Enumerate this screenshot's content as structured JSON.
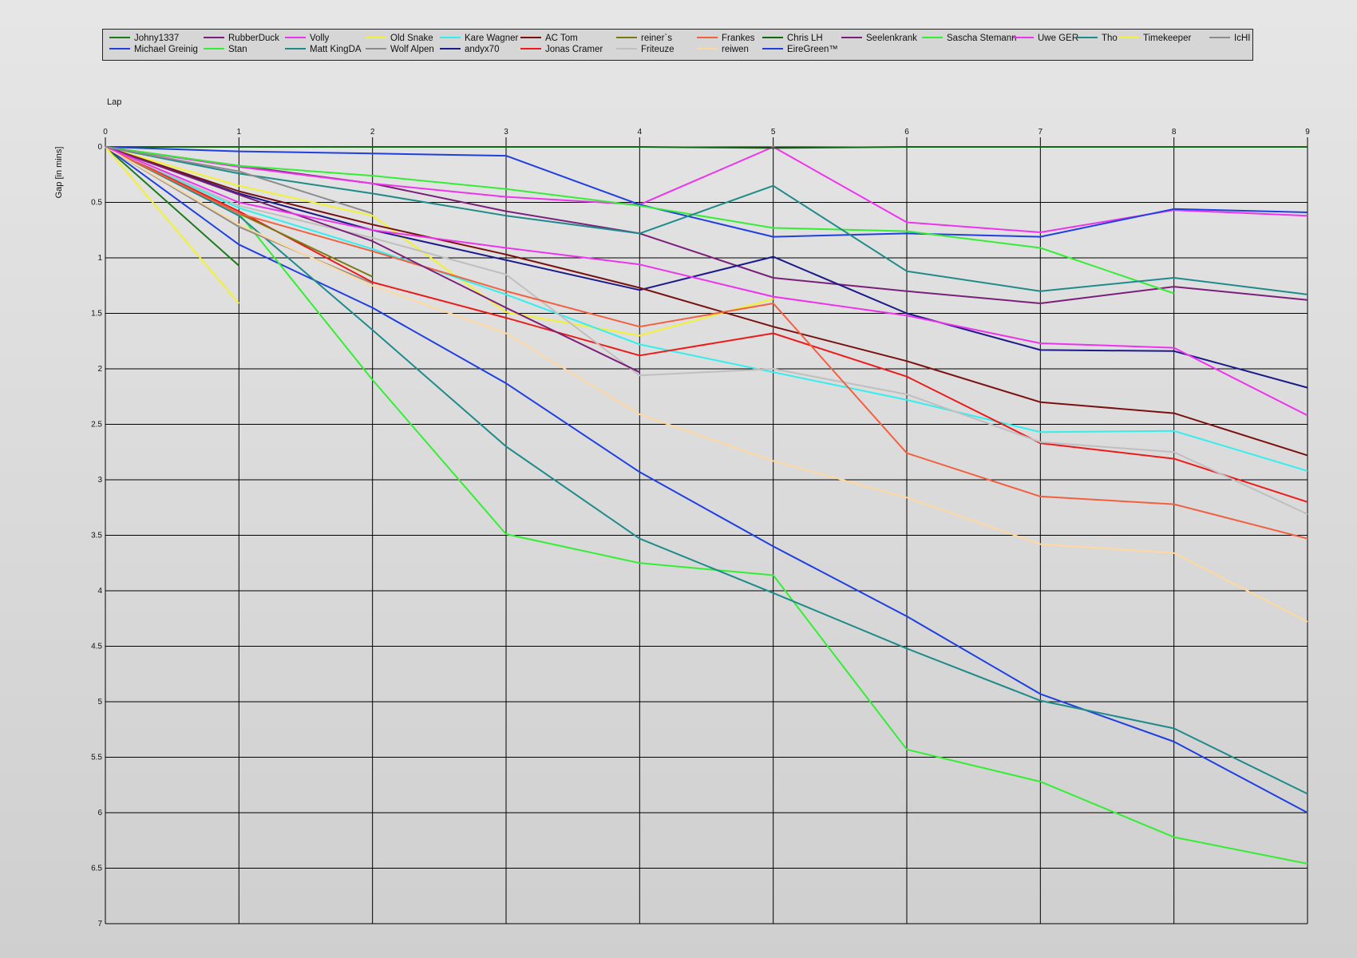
{
  "chart_data": {
    "type": "line",
    "xlabel": "Lap",
    "ylabel": "Gap [in mins]",
    "xlim": [
      0,
      9
    ],
    "ylim": [
      0,
      7
    ],
    "y_inverted": true,
    "grid": true,
    "legend_position": "top",
    "x_ticks": [
      "0",
      "1",
      "2",
      "3",
      "4",
      "5",
      "6",
      "7",
      "8",
      "9"
    ],
    "y_ticks": [
      "0",
      "0.5",
      "1",
      "1.5",
      "2",
      "2.5",
      "3",
      "3.5",
      "4",
      "4.5",
      "5",
      "5.5",
      "6",
      "6.5",
      "7"
    ],
    "x": [
      0,
      1,
      2,
      3,
      4,
      5,
      6,
      7,
      8,
      9
    ],
    "series": [
      {
        "name": "Johny1337",
        "color": "#1b7a1b",
        "values": [
          0,
          1.07
        ]
      },
      {
        "name": "Michael Greinig",
        "color": "#1f3fe0",
        "values": [
          0,
          0.88,
          1.45,
          2.13,
          2.93,
          3.6,
          4.23,
          4.93,
          5.36,
          6.0
        ]
      },
      {
        "name": "RubberDuck",
        "color": "#7a1f7a",
        "values": [
          0,
          0.17,
          0.33,
          0.58,
          0.78,
          1.18,
          1.3,
          1.41,
          1.26,
          1.38
        ]
      },
      {
        "name": "Stan",
        "color": "#33ee33",
        "values": [
          0,
          0.6,
          2.1,
          3.49,
          3.75,
          3.86,
          5.43,
          5.72,
          6.22,
          6.46
        ]
      },
      {
        "name": "Volly",
        "color": "#ee33ee",
        "values": [
          0,
          0.18,
          0.33,
          0.45,
          0.52,
          0.0,
          0.68,
          0.77,
          0.57,
          0.62
        ]
      },
      {
        "name": "Matt KingDA",
        "color": "#1f8a8a",
        "values": [
          0,
          0.62,
          1.65,
          2.7,
          3.53,
          4.02,
          4.52,
          4.99,
          5.24,
          5.83
        ]
      },
      {
        "name": "Old Snake",
        "color": "#f2f230",
        "values": [
          0,
          0.35,
          0.62,
          1.49,
          1.7,
          1.37
        ]
      },
      {
        "name": "Wolf Alpen",
        "color": "#8c8c8c",
        "values": [
          0,
          0.72,
          1.23
        ]
      },
      {
        "name": "Kare Wagner",
        "color": "#33eeee",
        "values": [
          0,
          0.55,
          0.92,
          1.33,
          1.78,
          2.03,
          2.28,
          2.57,
          2.56,
          2.92
        ]
      },
      {
        "name": "andyx70",
        "color": "#1a1a8a",
        "values": [
          0,
          0.42,
          0.75,
          1.02,
          1.29,
          0.99,
          1.5,
          1.83,
          1.84,
          2.17
        ]
      },
      {
        "name": "AC Tom",
        "color": "#7a1010",
        "values": [
          0,
          0.4,
          0.7,
          0.97,
          1.27,
          1.62,
          1.93,
          2.3,
          2.4,
          2.78
        ]
      },
      {
        "name": "Jonas Cramer",
        "color": "#ee1a1a",
        "values": [
          0,
          0.58,
          1.22,
          1.54,
          1.88,
          1.68,
          2.07,
          2.67,
          2.81,
          3.2
        ]
      },
      {
        "name": "reiner`s",
        "color": "#7a7a10",
        "values": [
          0,
          0.6,
          1.17
        ]
      },
      {
        "name": "Friteuze",
        "color": "#bfbfbf",
        "values": [
          0,
          0.53,
          0.82,
          1.15,
          2.06,
          2.0,
          2.23,
          2.66,
          2.75,
          3.31
        ]
      },
      {
        "name": "Frankes",
        "color": "#f26040",
        "values": [
          0,
          0.6,
          0.94,
          1.3,
          1.62,
          1.41,
          2.76,
          3.15,
          3.22,
          3.53
        ]
      },
      {
        "name": "reiwen",
        "color": "#ffd8a0",
        "values": [
          0,
          0.7,
          1.25,
          1.68,
          2.41,
          2.83,
          3.16,
          3.58,
          3.66,
          4.28
        ]
      },
      {
        "name": "Chris LH",
        "color": "#0f6a0f",
        "values": [
          0,
          0.0,
          0.0,
          0.0,
          0.0,
          0.01,
          0.0,
          0.0,
          0.0,
          0.0
        ]
      },
      {
        "name": "EireGreen™",
        "color": "#1f3fe0",
        "values": [
          0,
          0.04,
          0.06,
          0.08,
          0.52,
          0.81,
          0.78,
          0.81,
          0.56,
          0.59
        ]
      },
      {
        "name": "Seelenkrank",
        "color": "#7a207a",
        "values": [
          0,
          0.43,
          0.85,
          1.45,
          2.03
        ]
      },
      {
        "name": "Sascha Stemann",
        "color": "#33ee33",
        "values": [
          0,
          0.17,
          0.26,
          0.38,
          0.53,
          0.73,
          0.76,
          0.91,
          1.32
        ]
      },
      {
        "name": "Uwe GER",
        "color": "#ee33ee",
        "values": [
          0,
          0.5,
          0.75,
          0.91,
          1.06,
          1.35,
          1.52,
          1.77,
          1.81,
          2.42
        ]
      },
      {
        "name": "Tho",
        "color": "#1f8a8a",
        "values": [
          0,
          0.24,
          0.42,
          0.62,
          0.78,
          0.35,
          1.12,
          1.3,
          1.18,
          1.33
        ]
      },
      {
        "name": "Timekeeper",
        "color": "#f2f230",
        "values": [
          0,
          1.41
        ]
      },
      {
        "name": "IcHI",
        "color": "#8c8c8c",
        "values": [
          0,
          0.22,
          0.6
        ]
      }
    ]
  }
}
